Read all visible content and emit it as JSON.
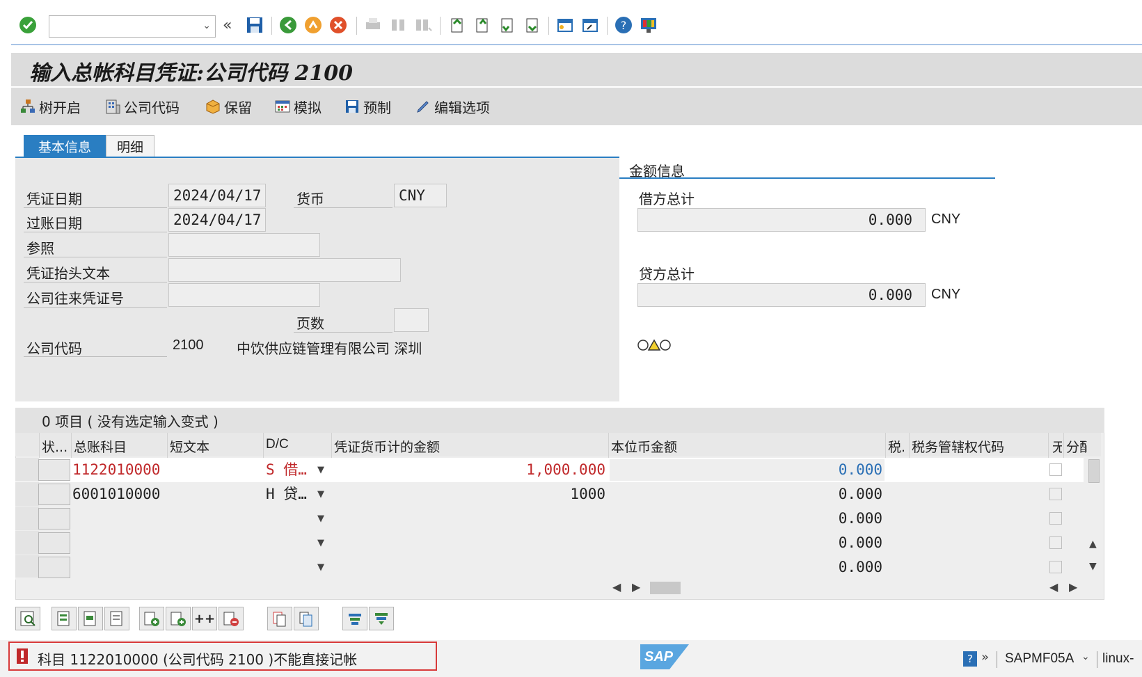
{
  "toolbar": {
    "command_value": "",
    "buttons": [
      "enter-icon",
      "back-arrows-icon",
      "save-icon",
      "back-icon",
      "exit-icon",
      "cancel-icon",
      "print-icon",
      "find-icon",
      "find-next-icon",
      "first-page-icon",
      "prev-page-icon",
      "next-page-icon",
      "last-page-icon",
      "new-session-icon",
      "shortcut-icon",
      "help-icon",
      "customize-icon"
    ]
  },
  "page": {
    "title": "输入总帐科目凭证:公司代码 2100"
  },
  "app_toolbar": {
    "tree": "树开启",
    "company_code": "公司代码",
    "park": "保留",
    "simulate": "模拟",
    "preprocess": "预制",
    "edit_options": "编辑选项"
  },
  "tabs": {
    "basic": "基本信息",
    "detail": "明细"
  },
  "header_fields": {
    "doc_date_label": "凭证日期",
    "doc_date": "2024/04/17",
    "currency_label": "货币",
    "currency": "CNY",
    "posting_date_label": "过账日期",
    "posting_date": "2024/04/17",
    "reference_label": "参照",
    "reference": "",
    "header_text_label": "凭证抬头文本",
    "header_text": "",
    "cross_cc_label": "公司往来凭证号",
    "cross_cc": "",
    "page_label": "页数",
    "page": "",
    "company_code_label": "公司代码",
    "company_code": "2100",
    "company_name": "中饮供应链管理有限公司 深圳"
  },
  "amount_info": {
    "title": "金额信息",
    "debit_label": "借方总计",
    "debit_value": "0.000",
    "debit_currency": "CNY",
    "credit_label": "贷方总计",
    "credit_value": "0.000",
    "credit_currency": "CNY",
    "balance_icon": "traffic-light-yellow-icon"
  },
  "items": {
    "title": "0 项目 ( 没有选定输入变式 )",
    "columns": [
      "状...",
      "总账科目",
      "短文本",
      "D/C",
      "凭证货币计的金额",
      "本位币金额",
      "税.",
      "税务管辖权代码",
      "无",
      "分配"
    ],
    "rows": [
      {
        "account": "1122010000",
        "text": "",
        "dc": "S 借…",
        "amount": "1,000.000",
        "local": "0.000"
      },
      {
        "account": "6001010000",
        "text": "",
        "dc": "H 贷…",
        "amount": "1000",
        "local": "0.000"
      },
      {
        "account": "",
        "text": "",
        "dc": "",
        "amount": "",
        "local": "0.000"
      },
      {
        "account": "",
        "text": "",
        "dc": "",
        "amount": "",
        "local": "0.000"
      },
      {
        "account": "",
        "text": "",
        "dc": "",
        "amount": "",
        "local": "0.000"
      }
    ]
  },
  "status": {
    "message": "科目 1122010000 (公司代码 2100 )不能直接记帐",
    "program": "SAPMF05A",
    "server": "linux-",
    "logo": "SAP"
  },
  "colors": {
    "accent": "#2a7ec2",
    "error": "#c0282a",
    "error_text": "#c0282a",
    "local_blue": "#2a6fb5"
  }
}
